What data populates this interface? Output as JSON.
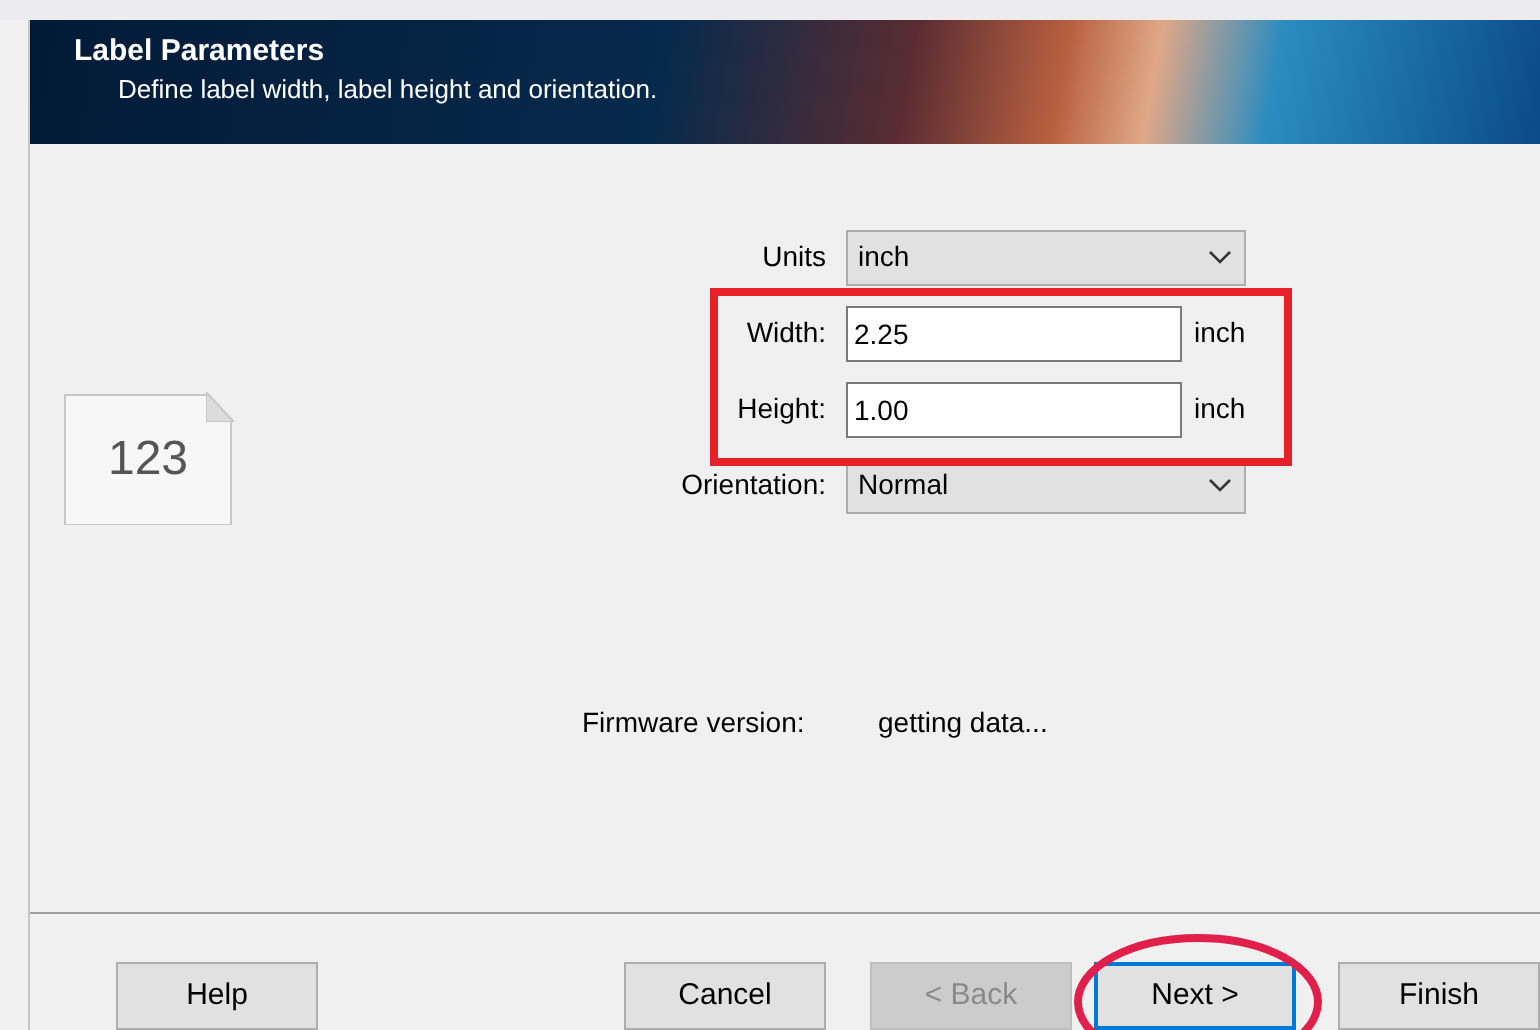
{
  "header": {
    "title": "Label Parameters",
    "subtitle": "Define label width, label height and orientation."
  },
  "preview": {
    "text": "123"
  },
  "fields": [
    {
      "kind": "dropdown",
      "label": "Units",
      "value": "inch",
      "highlighted": false
    },
    {
      "kind": "text",
      "label": "Width:",
      "value": "2.25",
      "unit": "inch",
      "highlighted": true
    },
    {
      "kind": "text",
      "label": "Height:",
      "value": "1.00",
      "unit": "inch",
      "highlighted": true
    },
    {
      "kind": "dropdown",
      "label": "Orientation:",
      "value": "Normal",
      "highlighted": false
    }
  ],
  "firmware": {
    "label": "Firmware version:",
    "value": "getting data..."
  },
  "buttons": [
    {
      "label": "Help",
      "disabled": false,
      "default": false,
      "circled": false
    },
    {
      "label": "Cancel",
      "disabled": false,
      "default": false,
      "circled": false
    },
    {
      "label": "< Back",
      "disabled": true,
      "default": false,
      "circled": false
    },
    {
      "label": "Next >",
      "disabled": false,
      "default": true,
      "circled": true
    },
    {
      "label": "Finish",
      "disabled": false,
      "default": false,
      "circled": false
    }
  ]
}
